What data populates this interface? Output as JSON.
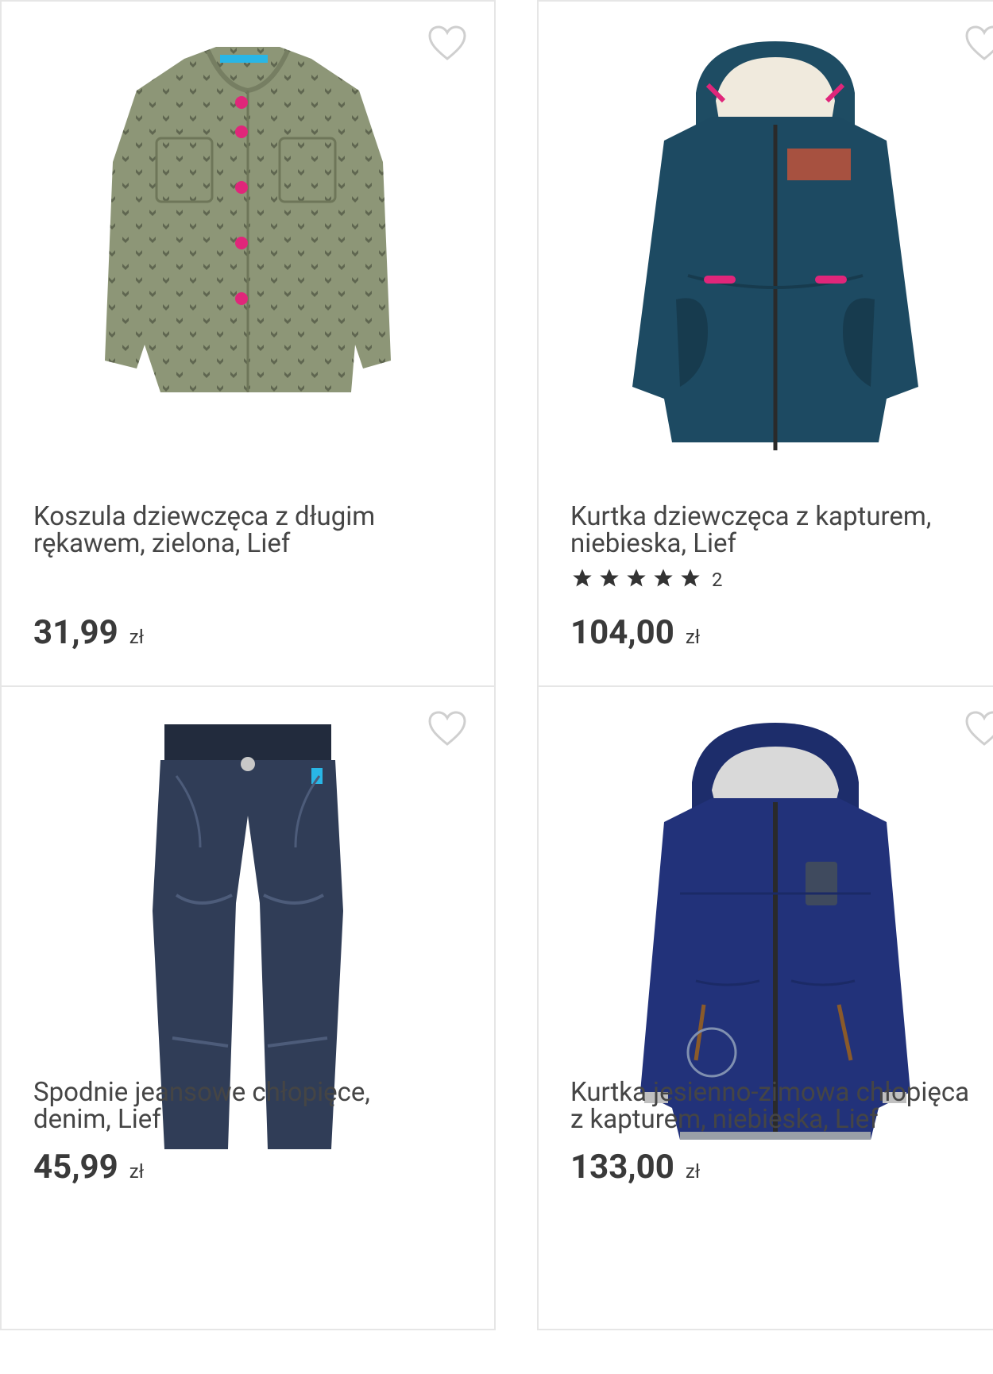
{
  "products": [
    {
      "title_line1": "Koszula dziewczęca z długim",
      "title_line2": "rękawem, zielona, Lief",
      "price": "31,99",
      "currency": "zł",
      "image_icon": "green-shirt-image",
      "favorite_icon": "heart-icon"
    },
    {
      "title_line1": "Kurtka dziewczęca z kapturem,",
      "title_line2": "niebieska, Lief",
      "rating_stars": 5,
      "rating_count": "2",
      "price": "104,00",
      "currency": "zł",
      "image_icon": "teal-parka-image",
      "favorite_icon": "heart-icon"
    },
    {
      "title_line1": "Spodnie jeansowe chłopięce,",
      "title_line2": "denim, Lief",
      "price": "45,99",
      "currency": "zł",
      "image_icon": "jeans-image",
      "favorite_icon": "heart-icon"
    },
    {
      "title_line1": "Kurtka jesienno-zimowa chłopięca",
      "title_line2": "z kapturem, niebieska, Lief",
      "price": "133,00",
      "currency": "zł",
      "image_icon": "navy-jacket-image",
      "favorite_icon": "heart-icon"
    }
  ],
  "colors": {
    "border": "#e6e6e6",
    "text": "#454545",
    "price": "#3a3a3a",
    "heart": "#cfcfcf"
  }
}
